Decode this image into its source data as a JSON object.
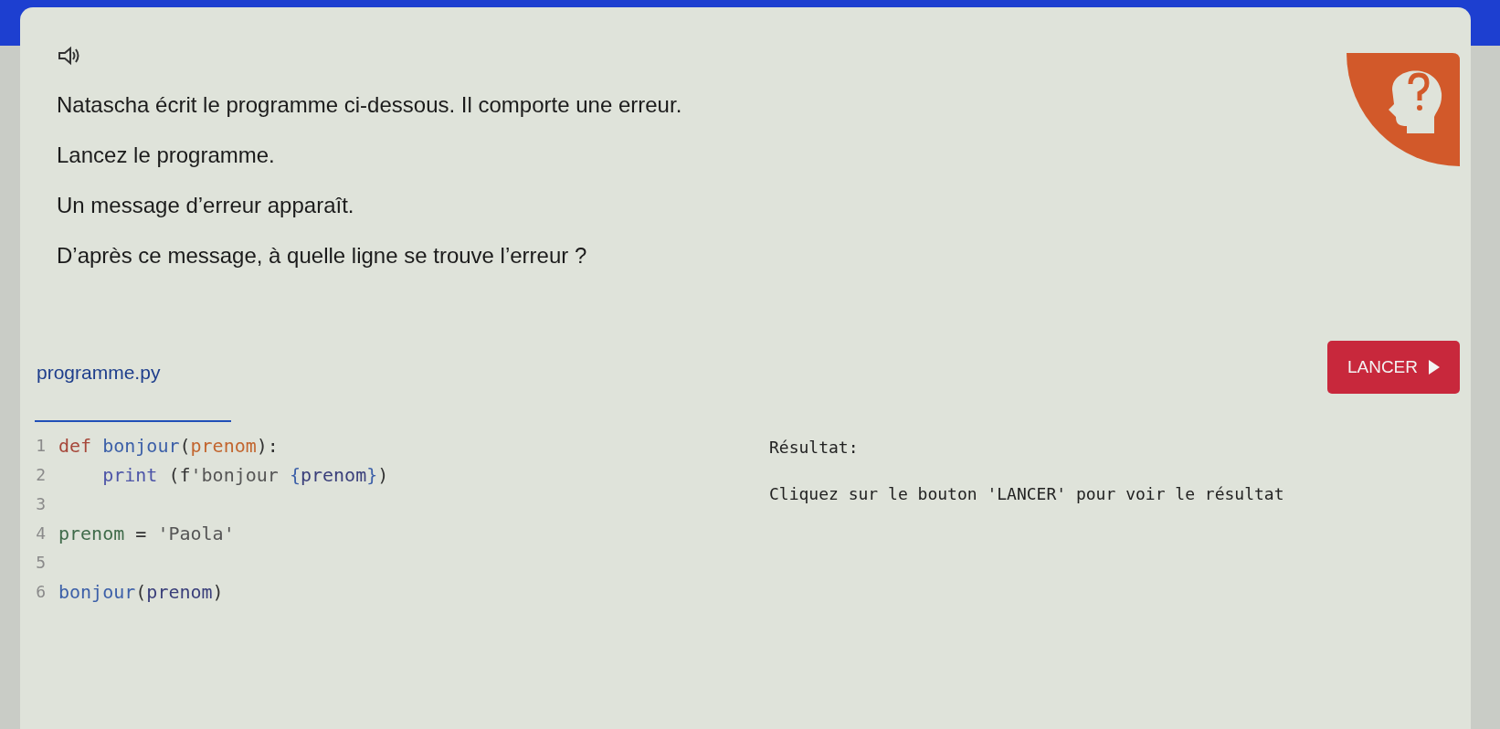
{
  "questions": [
    "Natascha écrit le programme ci-dessous. Il comporte une erreur.",
    "Lancez le programme.",
    "Un message d’erreur apparaît.",
    "D’après ce message, à quelle ligne se trouve l’erreur ?"
  ],
  "editor": {
    "tabs": [
      {
        "label": "programme.py",
        "selected": true
      }
    ],
    "run_button": "LANCER",
    "lines": [
      {
        "number": "1",
        "tokens": [
          {
            "kind": "keyword",
            "text": "def "
          },
          {
            "kind": "function",
            "text": "bonjour"
          },
          {
            "kind": "punct",
            "text": "("
          },
          {
            "kind": "param",
            "text": "prenom"
          },
          {
            "kind": "punct",
            "text": "):"
          }
        ]
      },
      {
        "number": "2",
        "tokens": [
          {
            "kind": "builtin",
            "text": "    print "
          },
          {
            "kind": "punct",
            "text": "(f"
          },
          {
            "kind": "string",
            "text": "'bonjour "
          },
          {
            "kind": "function",
            "text": "{"
          },
          {
            "kind": "plain",
            "text": "prenom"
          },
          {
            "kind": "function",
            "text": "}"
          },
          {
            "kind": "punct",
            "text": ")"
          }
        ]
      },
      {
        "number": "3"
      },
      {
        "number": "4",
        "tokens": [
          {
            "kind": "variable",
            "text": "prenom "
          },
          {
            "kind": "punct",
            "text": "= "
          },
          {
            "kind": "string",
            "text": "'Paola'"
          }
        ]
      },
      {
        "number": "5"
      },
      {
        "number": "6",
        "tokens": [
          {
            "kind": "function",
            "text": "bonjour"
          },
          {
            "kind": "punct",
            "text": "("
          },
          {
            "kind": "plain",
            "text": "prenom"
          },
          {
            "kind": "punct",
            "text": ")"
          }
        ]
      }
    ],
    "output": {
      "label": "Résultat:",
      "message": "Cliquez sur le bouton 'LANCER' pour voir le résultat"
    }
  }
}
